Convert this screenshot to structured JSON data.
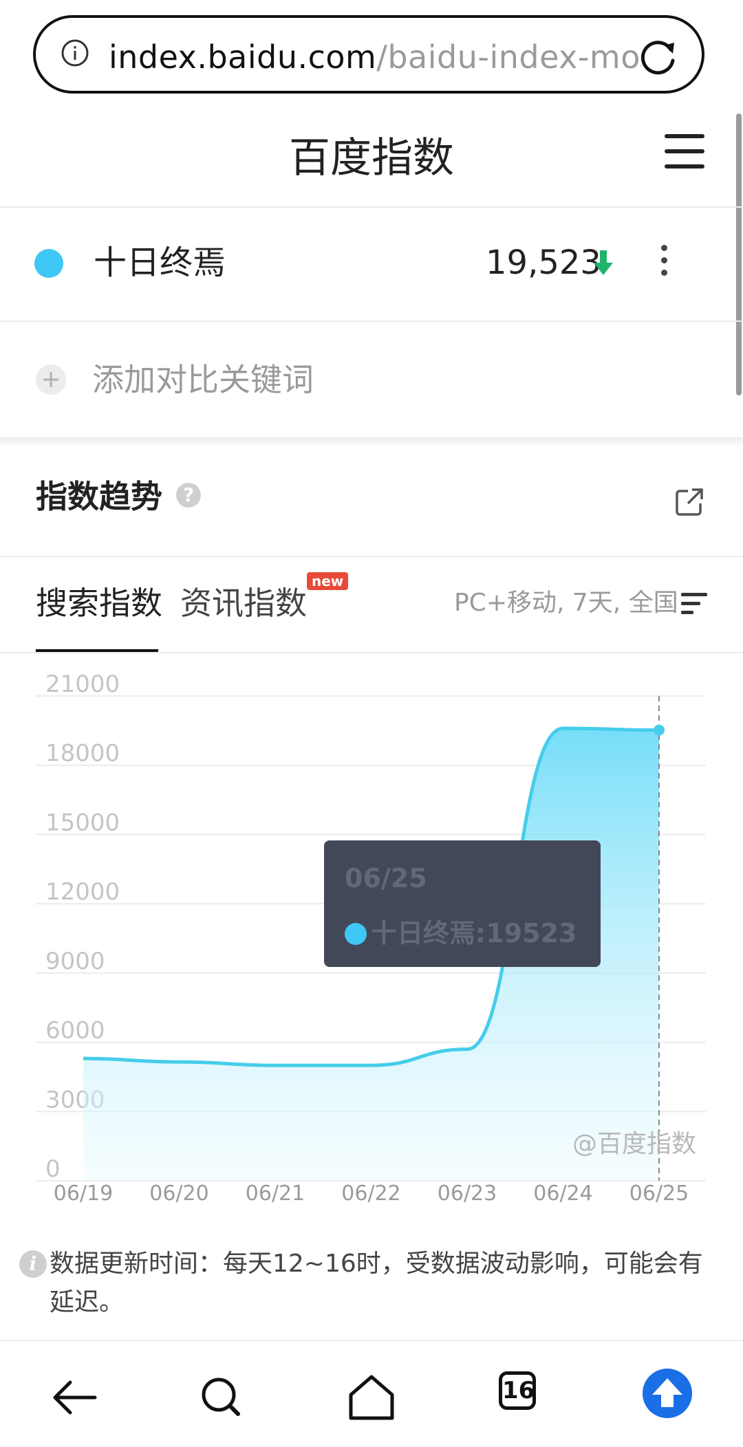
{
  "browser": {
    "url_host": "index.baidu.com",
    "url_path": "/baidu-index-mo"
  },
  "header": {
    "title": "百度指数"
  },
  "keyword": {
    "name": "十日终焉",
    "value": "19,523",
    "trend": "down",
    "color": "#3fc7f5"
  },
  "compare": {
    "add_label": "添加对比关键词"
  },
  "trend": {
    "title": "指数趋势",
    "tabs": [
      {
        "label": "搜索指数",
        "active": true
      },
      {
        "label": "资讯指数",
        "badge": "new"
      }
    ],
    "filter": "PC+移动, 7天, 全国"
  },
  "tooltip": {
    "date": "06/25",
    "series": "十日终焉:19523"
  },
  "watermark": "@百度指数",
  "note": "数据更新时间：每天12~16时，受数据波动影响，可能会有延迟。",
  "bottom_nav": {
    "tab_count": "16"
  },
  "chart_data": {
    "type": "area",
    "x": [
      "06/19",
      "06/20",
      "06/21",
      "06/22",
      "06/23",
      "06/24",
      "06/25"
    ],
    "series": [
      {
        "name": "十日终焉",
        "values": [
          5300,
          5150,
          5000,
          5000,
          5700,
          19600,
          19523
        ],
        "color": "#3fc7f5"
      }
    ],
    "y_ticks": [
      0,
      3000,
      6000,
      9000,
      12000,
      15000,
      18000,
      21000
    ],
    "ylim": [
      0,
      21000
    ],
    "grid": true,
    "highlight_x": "06/25"
  }
}
